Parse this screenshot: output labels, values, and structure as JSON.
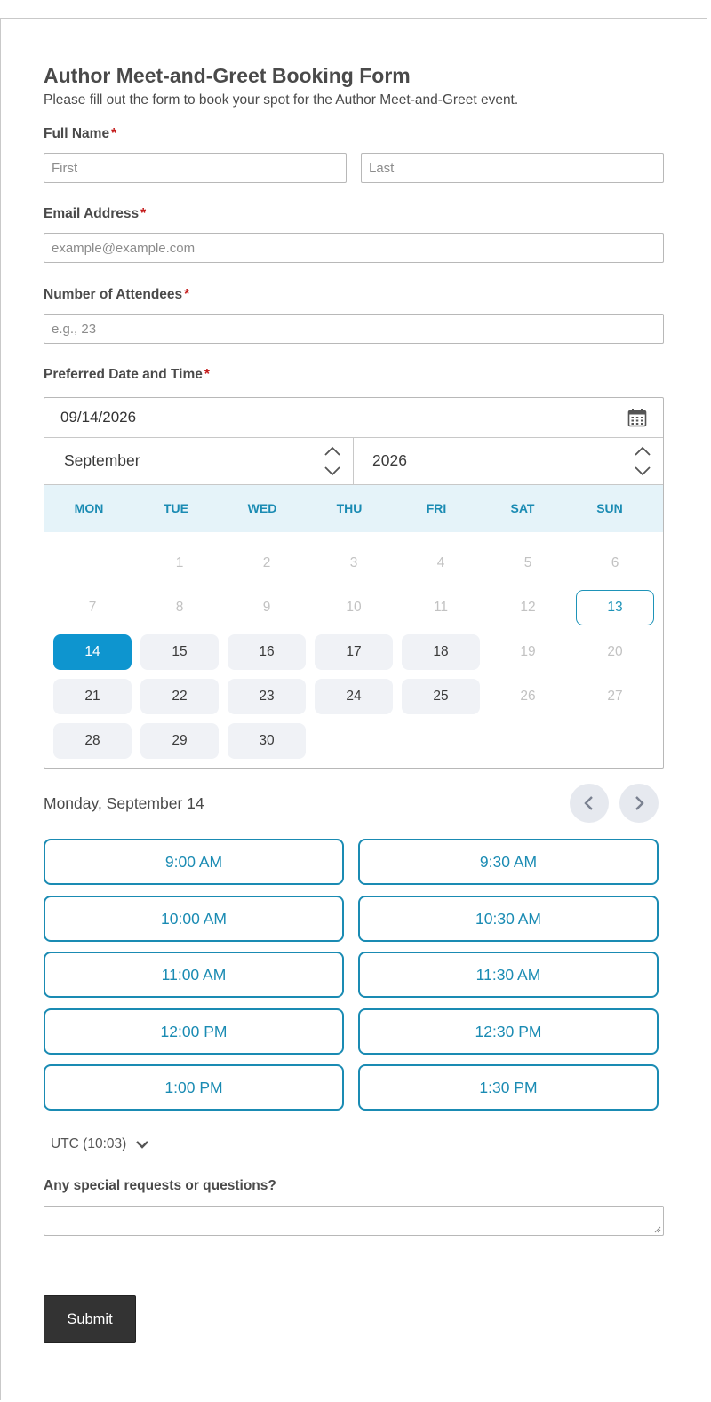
{
  "form": {
    "title": "Author Meet-and-Greet Booking Form",
    "description": "Please fill out the form to book your spot for the Author Meet-and-Greet event.",
    "required_marker": "*"
  },
  "full_name": {
    "label": "Full Name",
    "first_placeholder": "First",
    "last_placeholder": "Last"
  },
  "email": {
    "label": "Email Address",
    "placeholder": "example@example.com"
  },
  "attendees": {
    "label": "Number of Attendees",
    "placeholder": "e.g., 23"
  },
  "date_time": {
    "label": "Preferred Date and Time",
    "date_value": "09/14/2026",
    "calendar_icon": "calendar-icon",
    "month": "September",
    "year": "2026",
    "weekdays": [
      "MON",
      "TUE",
      "WED",
      "THU",
      "FRI",
      "SAT",
      "SUN"
    ],
    "weeks": [
      [
        null,
        {
          "d": "1",
          "s": "disabled"
        },
        {
          "d": "2",
          "s": "disabled"
        },
        {
          "d": "3",
          "s": "disabled"
        },
        {
          "d": "4",
          "s": "disabled"
        },
        {
          "d": "5",
          "s": "disabled"
        },
        {
          "d": "6",
          "s": "disabled"
        }
      ],
      [
        {
          "d": "7",
          "s": "disabled"
        },
        {
          "d": "8",
          "s": "disabled"
        },
        {
          "d": "9",
          "s": "disabled"
        },
        {
          "d": "10",
          "s": "disabled"
        },
        {
          "d": "11",
          "s": "disabled"
        },
        {
          "d": "12",
          "s": "disabled"
        },
        {
          "d": "13",
          "s": "today"
        }
      ],
      [
        {
          "d": "14",
          "s": "selected"
        },
        {
          "d": "15",
          "s": "avail"
        },
        {
          "d": "16",
          "s": "avail"
        },
        {
          "d": "17",
          "s": "avail"
        },
        {
          "d": "18",
          "s": "avail"
        },
        {
          "d": "19",
          "s": "disabled"
        },
        {
          "d": "20",
          "s": "disabled"
        }
      ],
      [
        {
          "d": "21",
          "s": "avail"
        },
        {
          "d": "22",
          "s": "avail"
        },
        {
          "d": "23",
          "s": "avail"
        },
        {
          "d": "24",
          "s": "avail"
        },
        {
          "d": "25",
          "s": "avail"
        },
        {
          "d": "26",
          "s": "disabled"
        },
        {
          "d": "27",
          "s": "disabled"
        }
      ],
      [
        {
          "d": "28",
          "s": "avail"
        },
        {
          "d": "29",
          "s": "avail"
        },
        {
          "d": "30",
          "s": "avail"
        },
        null,
        null,
        null,
        null
      ]
    ],
    "selected_heading": "Monday, September 14",
    "prev_icon": "chevron-left-icon",
    "next_icon": "chevron-right-icon",
    "time_slots": [
      "9:00 AM",
      "9:30 AM",
      "10:00 AM",
      "10:30 AM",
      "11:00 AM",
      "11:30 AM",
      "12:00 PM",
      "12:30 PM",
      "1:00 PM",
      "1:30 PM"
    ],
    "timezone": "UTC (10:03)",
    "timezone_icon": "chevron-down-icon"
  },
  "special_requests": {
    "label": "Any special requests or questions?",
    "value": ""
  },
  "submit": {
    "label": "Submit"
  },
  "colors": {
    "accent": "#1a8bb3",
    "selected_day": "#0e95cf",
    "weekday_header_bg": "#e5f3f9",
    "required": "#c41c1c",
    "submit_bg": "#333333"
  }
}
